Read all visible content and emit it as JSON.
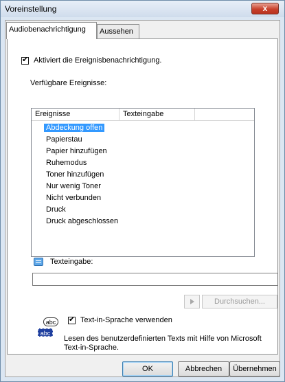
{
  "window": {
    "title": "Voreinstellung",
    "close_label": "x"
  },
  "tabs": [
    {
      "label": "Audiobenachrichtigung",
      "active": true
    },
    {
      "label": "Aussehen",
      "active": false
    }
  ],
  "audio": {
    "enable_checkbox": {
      "label": "Aktiviert die Ereignisbenachrichtigung.",
      "checked": true
    },
    "events_label": "Verfügbare Ereignisse:",
    "columns": [
      "Ereignisse",
      "Texteingabe"
    ],
    "events": [
      {
        "name": "Abdeckung offen",
        "selected": true
      },
      {
        "name": "Papierstau",
        "selected": false
      },
      {
        "name": "Papier hinzufügen",
        "selected": false
      },
      {
        "name": "Ruhemodus",
        "selected": false
      },
      {
        "name": "Toner hinzufügen",
        "selected": false
      },
      {
        "name": "Nur wenig Toner",
        "selected": false
      },
      {
        "name": "Nicht verbunden",
        "selected": false
      },
      {
        "name": "Druck",
        "selected": false
      },
      {
        "name": "Druck abgeschlossen",
        "selected": false
      }
    ],
    "text_input_label": "Texteingabe:",
    "text_input_value": "",
    "browse_label": "Durchsuchen...",
    "tts_icon_top": "abc",
    "tts_icon_bottom": "abc",
    "tts_checkbox": {
      "label": "Text-in-Sprache verwenden",
      "checked": true
    },
    "description": "Lesen des benutzerdefinierten Texts mit Hilfe von Microsoft Text-in-Sprache."
  },
  "buttons": {
    "ok": "OK",
    "cancel": "Abbrechen",
    "apply": "Übernehmen"
  }
}
